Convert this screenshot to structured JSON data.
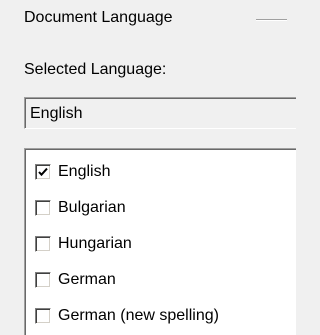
{
  "group": {
    "title": "Document Language"
  },
  "selected_label": "Selected Language:",
  "current_language": "English",
  "languages": [
    {
      "label": "English",
      "checked": true
    },
    {
      "label": "Bulgarian",
      "checked": false
    },
    {
      "label": "Hungarian",
      "checked": false
    },
    {
      "label": "German",
      "checked": false
    },
    {
      "label": "German (new spelling)",
      "checked": false
    }
  ],
  "icons": {
    "check": "checkmark-icon"
  }
}
